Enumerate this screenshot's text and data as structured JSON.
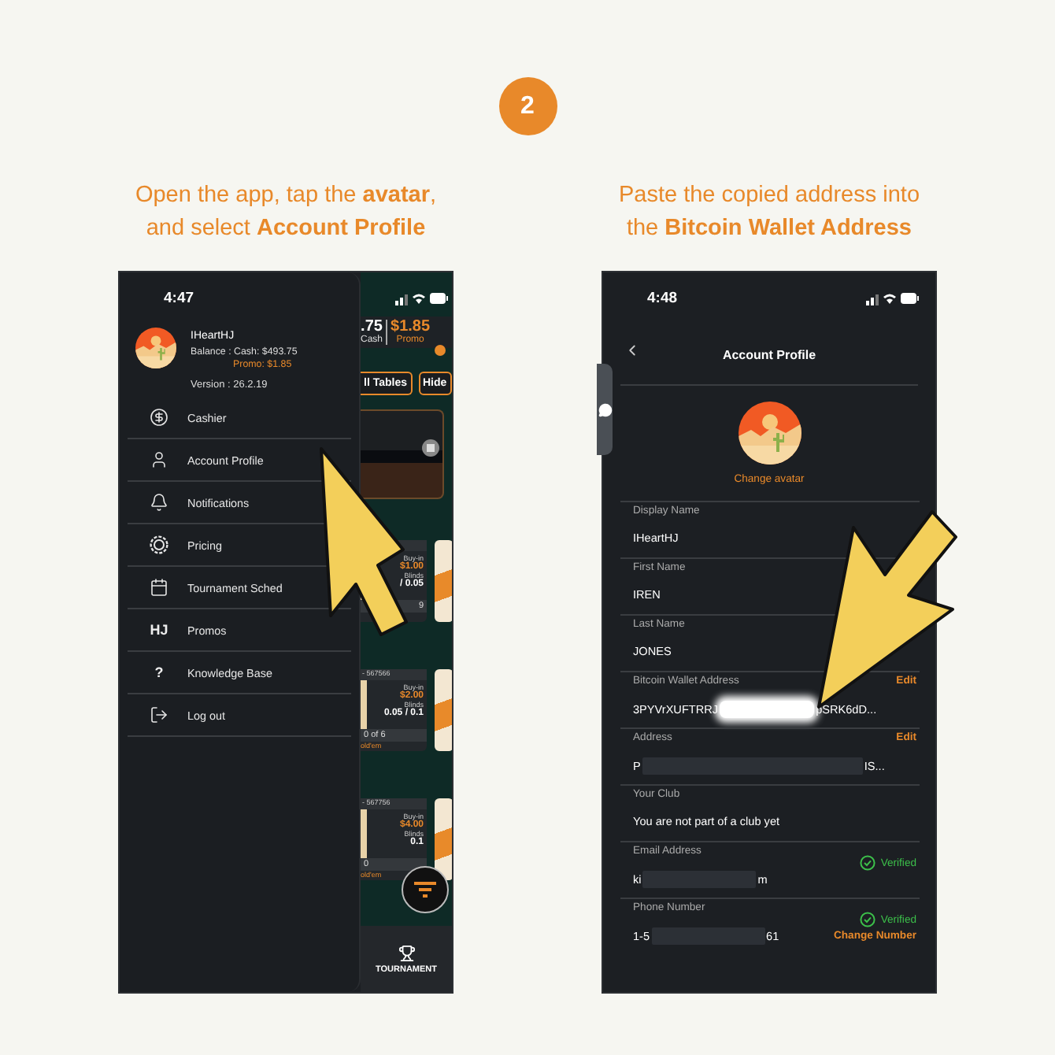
{
  "step": "2",
  "captions": [
    {
      "lines": [
        "Open the app, tap the **avatar**,",
        "and select **Account Profile**"
      ]
    },
    {
      "lines": [
        "Paste the copied address into",
        "the **Bitcoin Wallet Address**"
      ]
    }
  ],
  "menu_phone": {
    "time": "4:47",
    "profile": {
      "name": "IHeartHJ",
      "balance": "Balance : Cash: $493.75",
      "promo": "Promo: $1.85",
      "version": "Version : 26.2.19"
    },
    "menu": [
      {
        "label": "Cashier"
      },
      {
        "label": "Account Profile"
      },
      {
        "label": "Notifications"
      },
      {
        "label": "Pricing"
      },
      {
        "label": "Tournament Sched"
      },
      {
        "label": "Promos",
        "icon_text": "HJ"
      },
      {
        "label": "Knowledge Base",
        "icon_text": "?"
      },
      {
        "label": "Log out"
      }
    ],
    "lobby": {
      "cash": ".75",
      "cash_label": "Cash",
      "promo": "$1.85",
      "promo_label": "Promo",
      "buttons": [
        "ll Tables",
        "Hide"
      ],
      "tables": [
        {
          "buy_in_label": "Buy-in",
          "buy_in": "$1.00",
          "blinds_label": "Blinds",
          "blinds": "/ 0.05",
          "seats": "9"
        },
        {
          "header": "- 567566",
          "buy_in_label": "Buy-in",
          "buy_in": "$2.00",
          "blinds_label": "Blinds",
          "blinds": "0.05 / 0.1",
          "seats": "0 of 6",
          "game": "old'em"
        },
        {
          "header": "- 567756",
          "buy_in_label": "Buy-in",
          "buy_in": "$4.00",
          "blinds_label": "Blinds",
          "blinds": "0.1",
          "seats": "0",
          "game": "old'em"
        }
      ],
      "nav": "TOURNAMENT"
    }
  },
  "profile_phone": {
    "time": "4:48",
    "title": "Account Profile",
    "change_avatar": "Change avatar",
    "fields": [
      {
        "kind": "plain",
        "label": "Display Name",
        "value": "IHeartHJ"
      },
      {
        "kind": "plain",
        "label": "First Name",
        "value": "IREN"
      },
      {
        "kind": "plain",
        "label": "Last Name",
        "value": "JONES"
      },
      {
        "kind": "blurred",
        "label": "Bitcoin Wallet Address",
        "value": "3PYVrXUFTRRJ",
        "value_end": "pSRK6dD...",
        "action": "Edit"
      },
      {
        "kind": "masked",
        "label": "Address",
        "value": "P",
        "value_end": "IS...",
        "action": "Edit"
      },
      {
        "kind": "plain",
        "label": "Your Club",
        "value": "You are not part of a club yet"
      },
      {
        "kind": "masked",
        "label": "Email Address",
        "value": "ki",
        "value_end": "m",
        "status": "Verified"
      },
      {
        "kind": "masked",
        "label": "Phone Number",
        "value": "1-5",
        "value_end": "61",
        "status": "Verified",
        "action": "Change Number"
      }
    ]
  }
}
